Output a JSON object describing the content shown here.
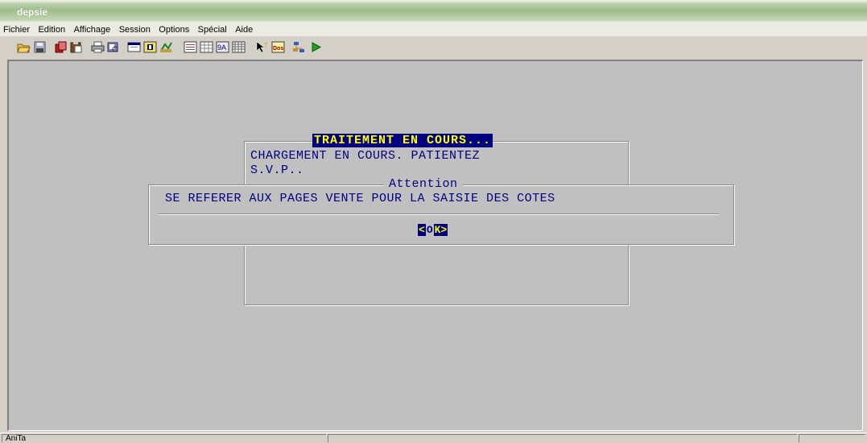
{
  "window": {
    "title": "depsie"
  },
  "menu": [
    "Fichier",
    "Edition",
    "Affichage",
    "Session",
    "Options",
    "Spécial",
    "Aide"
  ],
  "toolbar": {
    "icons": [
      "open-folder-icon",
      "save-disk-icon",
      "copy-icon",
      "paste-icon",
      "print-icon",
      "print-preview-icon",
      "window-icon",
      "window-yellow-icon",
      "refresh-icon",
      "list-icon",
      "table-icon",
      "sort-icon",
      "grid-icon",
      "cursor-help-icon",
      "docs-icon",
      "network-icon",
      "play-icon"
    ]
  },
  "dialog": {
    "progress_title": "TRAITEMENT EN COURS...",
    "message_line1": "CHARGEMENT EN COURS. PATIENTEZ",
    "message_line2": "S.V.P..",
    "alert_title": "Attention",
    "alert_text": "SE REFERER AUX PAGES VENTE POUR LA SAISIE DES COTES",
    "ok_left": "<",
    "ok_mid": "O",
    "ok_right": "K>"
  },
  "status": {
    "pane1": "AniTa"
  },
  "colors": {
    "terminal_text": "#000080",
    "highlight_bg": "#000080",
    "highlight_fg": "#ffff00"
  }
}
